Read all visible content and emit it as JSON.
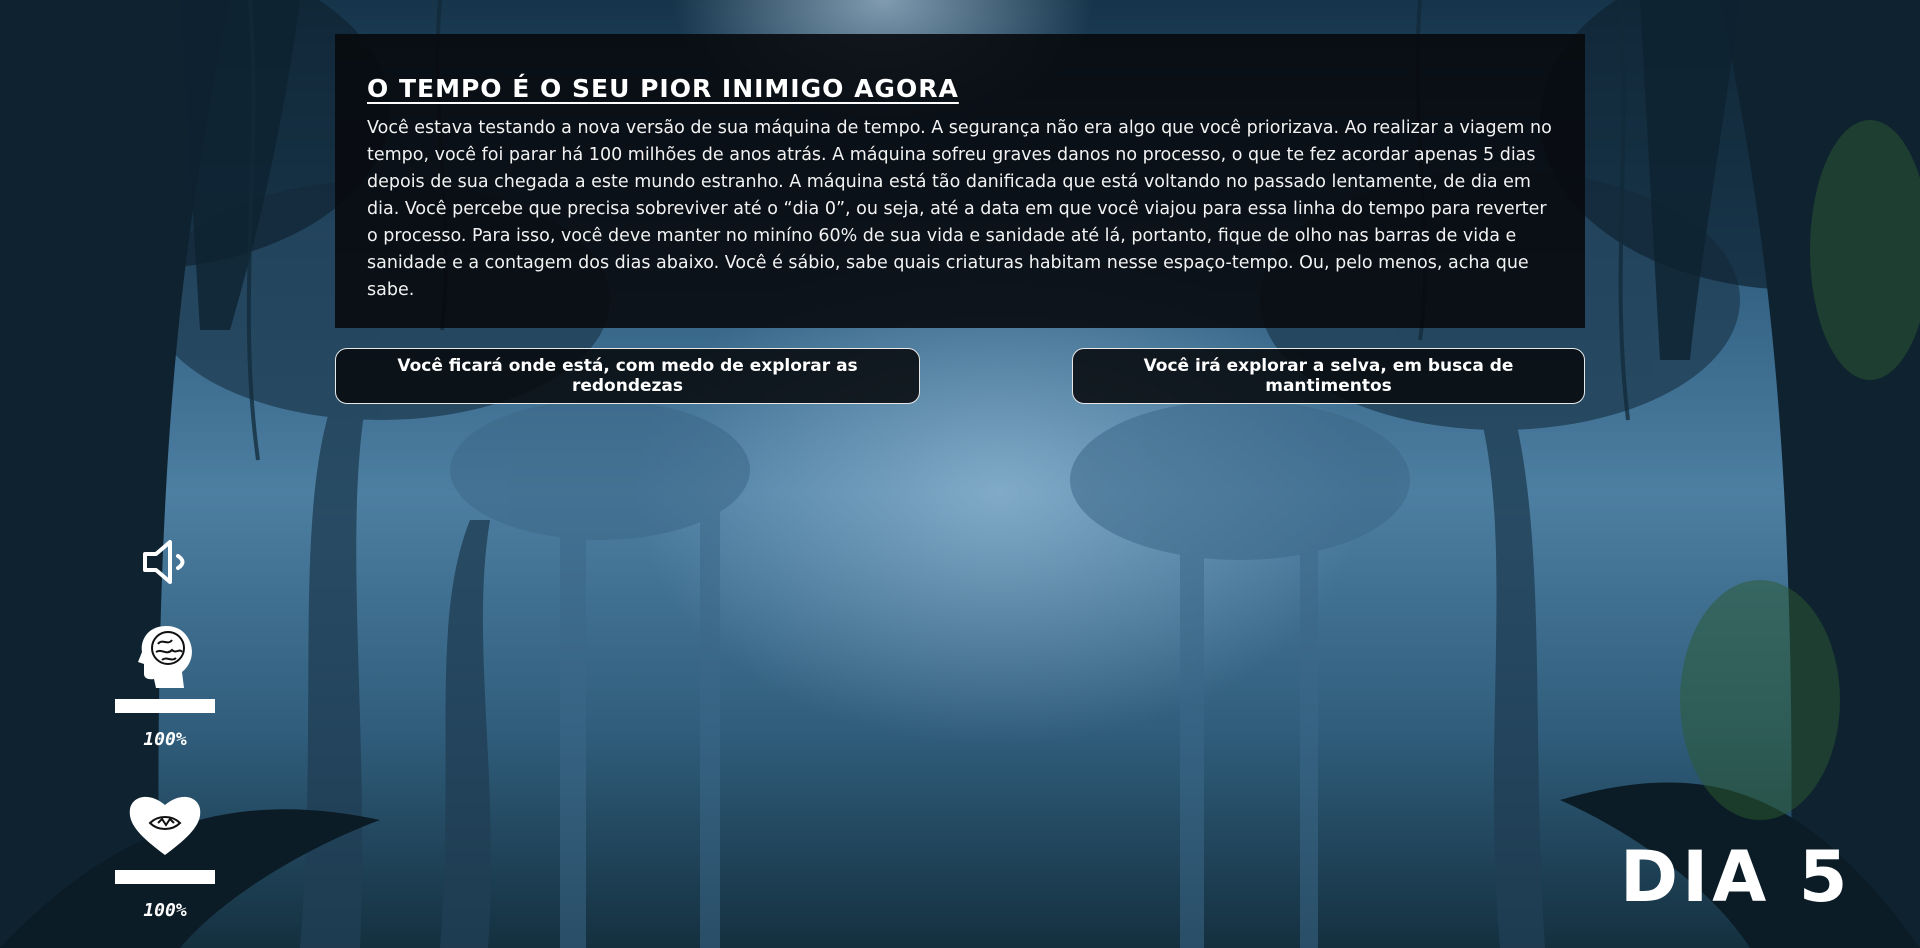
{
  "story": {
    "title": "O tempo é o seu pior inimigo agora",
    "text": "Você estava testando a nova versão de sua máquina de tempo. A segurança não era algo que você priorizava. Ao realizar a viagem no tempo, você foi parar há 100 milhões de anos atrás. A máquina sofreu graves danos no processo, o que te fez acordar apenas 5 dias depois de sua chegada a este mundo estranho. A máquina está tão danificada que está voltando no passado lentamente, de dia em dia. Você percebe que precisa sobreviver até o “dia 0”, ou seja, até a data em que você viajou para essa linha do tempo para reverter o processo. Para isso, você deve manter no miníno 60% de sua vida e sanidade até lá, portanto, fique de olho nas barras de vida e sanidade e a contagem dos dias abaixo. Você é sábio, sabe quais criaturas habitam nesse espaço-tempo. Ou, pelo menos, acha que sabe."
  },
  "choices": {
    "stay": "Você ficará onde está, com medo de explorar as redondezas",
    "explore": "Você irá explorar a selva, em busca de mantimentos"
  },
  "hud": {
    "sound_icon": "speaker-icon",
    "sanity": {
      "icon": "brain-head-icon",
      "value": 100,
      "label": "100%"
    },
    "health": {
      "icon": "heart-icon",
      "value": 100,
      "label": "100%"
    }
  },
  "day": {
    "label": "DIA 5"
  },
  "colors": {
    "panel": "#08090c",
    "text": "#ffffff",
    "sky": "#4d7fa2"
  }
}
